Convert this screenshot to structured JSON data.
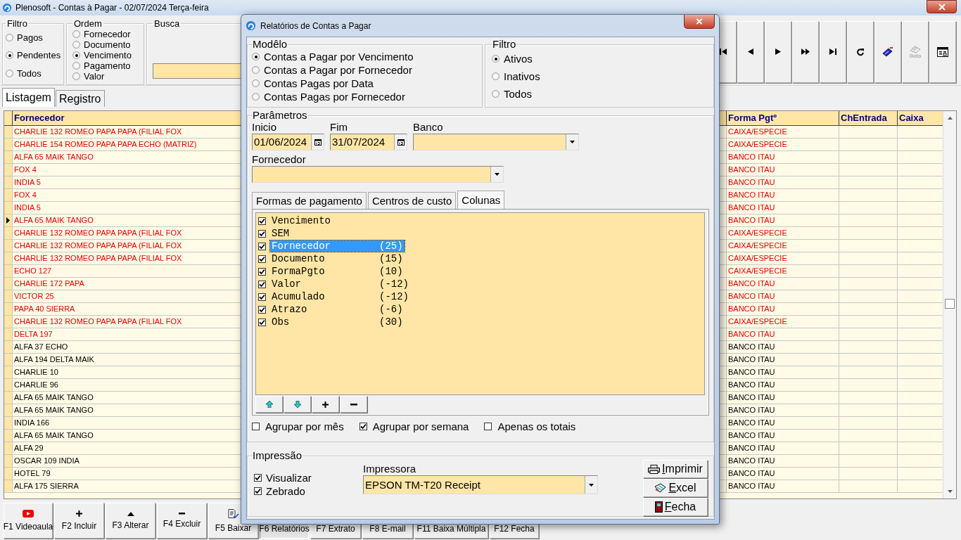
{
  "window": {
    "title": "Plenosoft - Contas à Pagar - 02/07/2024 Terça-feira"
  },
  "filtro": {
    "title": "Filtro",
    "options": [
      {
        "label": "Pagos",
        "selected": false
      },
      {
        "label": "Pendentes",
        "selected": true
      },
      {
        "label": "Todos",
        "selected": false
      }
    ]
  },
  "ordem": {
    "title": "Ordem",
    "options": [
      {
        "label": "Fornecedor",
        "selected": false
      },
      {
        "label": "Documento",
        "selected": false
      },
      {
        "label": "Vencimento",
        "selected": true
      },
      {
        "label": "Pagamento",
        "selected": false
      },
      {
        "label": "Valor",
        "selected": false
      }
    ]
  },
  "busca": {
    "title": "Busca"
  },
  "toolbar": [
    {
      "kind": "first",
      "disabled": false
    },
    {
      "kind": "prev",
      "disabled": false
    },
    {
      "kind": "next",
      "disabled": false
    },
    {
      "kind": "next_page",
      "disabled": false
    },
    {
      "kind": "last",
      "disabled": false
    },
    {
      "kind": "refresh",
      "disabled": false
    },
    {
      "kind": "tag",
      "disabled": false
    },
    {
      "kind": "goto",
      "label": "Goto",
      "disabled": true
    },
    {
      "kind": "form",
      "disabled": false
    }
  ],
  "tabs": [
    {
      "label": "Listagem",
      "selected": true
    },
    {
      "label": "Registro",
      "selected": false
    }
  ],
  "table": {
    "columns": [
      "Fornecedor",
      "Forma Pgtº",
      "ChEntrada",
      "Caixa"
    ],
    "rows": [
      {
        "fornecedor": "CHARLIE 132 ROMEO PAPA PAPA (FILIAL FOX",
        "forma": "CAIXA/ESPECIE",
        "overdue": true,
        "selected": false
      },
      {
        "fornecedor": "CHARLIE 154 ROMEO PAPA PAPA ECHO (MATRIZ)",
        "forma": "CAIXA/ESPECIE",
        "overdue": true,
        "selected": false
      },
      {
        "fornecedor": "ALFA 65 MAIK TANGO",
        "forma": "BANCO ITAU",
        "overdue": true,
        "selected": false
      },
      {
        "fornecedor": "FOX 4",
        "forma": "BANCO ITAU",
        "overdue": true,
        "selected": false
      },
      {
        "fornecedor": "INDIA 5",
        "forma": "BANCO ITAU",
        "overdue": true,
        "selected": false
      },
      {
        "fornecedor": "FOX 4",
        "forma": "BANCO ITAU",
        "overdue": true,
        "selected": false
      },
      {
        "fornecedor": "INDIA 5",
        "forma": "BANCO ITAU",
        "overdue": true,
        "selected": false
      },
      {
        "fornecedor": "ALFA 65 MAIK TANGO",
        "forma": "BANCO ITAU",
        "overdue": true,
        "selected": true
      },
      {
        "fornecedor": "CHARLIE 132 ROMEO PAPA PAPA (FILIAL FOX",
        "forma": "CAIXA/ESPECIE",
        "overdue": true,
        "selected": false
      },
      {
        "fornecedor": "CHARLIE 132 ROMEO PAPA PAPA (FILIAL FOX",
        "forma": "CAIXA/ESPECIE",
        "overdue": true,
        "selected": false
      },
      {
        "fornecedor": "CHARLIE 132 ROMEO PAPA PAPA (FILIAL FOX",
        "forma": "CAIXA/ESPECIE",
        "overdue": true,
        "selected": false
      },
      {
        "fornecedor": "ECHO 127",
        "forma": "CAIXA/ESPECIE",
        "overdue": true,
        "selected": false
      },
      {
        "fornecedor": "CHARLIE 172 PAPA",
        "forma": "BANCO ITAU",
        "overdue": true,
        "selected": false
      },
      {
        "fornecedor": "VICTOR 25",
        "forma": "BANCO ITAU",
        "overdue": true,
        "selected": false
      },
      {
        "fornecedor": "PAPA 40 SIERRA",
        "forma": "BANCO ITAU",
        "overdue": true,
        "selected": false
      },
      {
        "fornecedor": "CHARLIE 132 ROMEO PAPA PAPA (FILIAL FOX",
        "forma": "CAIXA/ESPECIE",
        "overdue": true,
        "selected": false
      },
      {
        "fornecedor": "DELTA 197",
        "forma": "BANCO ITAU",
        "overdue": true,
        "selected": false
      },
      {
        "fornecedor": "ALFA 37 ECHO",
        "forma": "BANCO ITAU",
        "overdue": false,
        "selected": false
      },
      {
        "fornecedor": "ALFA 194 DELTA MAIK",
        "forma": "BANCO ITAU",
        "overdue": false,
        "selected": false
      },
      {
        "fornecedor": "CHARLIE 10",
        "forma": "BANCO ITAU",
        "overdue": false,
        "selected": false
      },
      {
        "fornecedor": "CHARLIE 96",
        "forma": "BANCO ITAU",
        "overdue": false,
        "selected": false
      },
      {
        "fornecedor": "ALFA 65 MAIK TANGO",
        "forma": "BANCO ITAU",
        "overdue": false,
        "selected": false
      },
      {
        "fornecedor": "ALFA 65 MAIK TANGO",
        "forma": "BANCO ITAU",
        "overdue": false,
        "selected": false
      },
      {
        "fornecedor": "INDIA 166",
        "forma": "BANCO ITAU",
        "overdue": false,
        "selected": false
      },
      {
        "fornecedor": "ALFA 65 MAIK TANGO",
        "forma": "BANCO ITAU",
        "overdue": false,
        "selected": false
      },
      {
        "fornecedor": "ALFA 29",
        "forma": "BANCO ITAU",
        "overdue": false,
        "selected": false
      },
      {
        "fornecedor": "OSCAR 109 INDIA",
        "forma": "BANCO ITAU",
        "overdue": false,
        "selected": false
      },
      {
        "fornecedor": "HOTEL 79",
        "forma": "BANCO ITAU",
        "overdue": false,
        "selected": false
      },
      {
        "fornecedor": "ALFA 175 SIERRA",
        "forma": "BANCO ITAU",
        "overdue": false,
        "selected": false
      }
    ]
  },
  "function_keys": [
    {
      "label": "F1 Videoaula",
      "kind": "video",
      "pressed": false
    },
    {
      "label": "F2 Incluir",
      "kind": "add",
      "pressed": false
    },
    {
      "label": "F3 Alterar",
      "kind": "edit",
      "pressed": false
    },
    {
      "label": "F4 Excluir",
      "kind": "remove",
      "pressed": false
    },
    {
      "label": "F5 Baixar",
      "kind": "settle",
      "pressed": false
    },
    {
      "label": "F6 Relatórios",
      "kind": "text",
      "pressed": true
    },
    {
      "label": "F7 Extrato",
      "kind": "text",
      "pressed": false
    },
    {
      "label": "F8 E-mail",
      "kind": "text",
      "pressed": false
    },
    {
      "label": "F11 Baixa Múltipla",
      "kind": "text",
      "pressed": false
    },
    {
      "label": "F12 Fecha",
      "kind": "text",
      "pressed": false
    }
  ],
  "dialog": {
    "title": "Relatórios de Contas a Pagar",
    "modelo": {
      "title": "Modêlo",
      "options": [
        {
          "label": "Contas a Pagar por Vencimento",
          "selected": true
        },
        {
          "label": "Contas a Pagar por Fornecedor",
          "selected": false
        },
        {
          "label": "Contas Pagas por Data",
          "selected": false
        },
        {
          "label": "Contas Pagas por Fornecedor",
          "selected": false
        }
      ]
    },
    "filtro": {
      "title": "Filtro",
      "options": [
        {
          "label": "Ativos",
          "selected": true
        },
        {
          "label": "Inativos",
          "selected": false
        },
        {
          "label": "Todos",
          "selected": false
        }
      ]
    },
    "parametros": {
      "title": "Parâmetros",
      "inicio": {
        "label": "Inicio",
        "value": "01/06/2024"
      },
      "fim": {
        "label": "Fim",
        "value": "31/07/2024"
      },
      "banco": {
        "label": "Banco"
      },
      "fornecedor": {
        "label": "Fornecedor"
      },
      "tabs": [
        {
          "label": "Formas de pagamento",
          "selected": false
        },
        {
          "label": "Centros de custo",
          "selected": false
        },
        {
          "label": "Colunas",
          "selected": true
        }
      ],
      "columns": [
        {
          "name": "Vencimento",
          "checked": true,
          "selected": false
        },
        {
          "name": "SEM",
          "checked": true,
          "selected": false
        },
        {
          "name": "Fornecedor",
          "width": "(25)",
          "checked": true,
          "selected": true
        },
        {
          "name": "Documento",
          "width": "(15)",
          "checked": true,
          "selected": false
        },
        {
          "name": "FormaPgto",
          "width": "(10)",
          "checked": true,
          "selected": false
        },
        {
          "name": "Valor",
          "width": "(-12)",
          "checked": true,
          "selected": false
        },
        {
          "name": "Acumulado",
          "width": "(-12)",
          "checked": true,
          "selected": false
        },
        {
          "name": "Atrazo",
          "width": "(-6)",
          "checked": true,
          "selected": false
        },
        {
          "name": "Obs",
          "width": "(30)",
          "checked": true,
          "selected": false
        }
      ],
      "list_buttons": [
        {
          "kind": "up"
        },
        {
          "kind": "down"
        },
        {
          "kind": "add"
        },
        {
          "kind": "remove"
        }
      ],
      "options": [
        {
          "label": "Agrupar por mês",
          "checked": false
        },
        {
          "label": "Agrupar por semana",
          "checked": true
        },
        {
          "label": "Apenas os totais",
          "checked": false
        }
      ]
    },
    "impressao": {
      "title": "Impressão",
      "options": [
        {
          "label": "Visualizar",
          "checked": true
        },
        {
          "label": "Zebrado",
          "checked": true
        }
      ],
      "printer": {
        "label": "Impressora",
        "value": "EPSON TM-T20 Receipt"
      },
      "buttons": [
        {
          "label": "Imprimir",
          "kind": "print"
        },
        {
          "label": "Excel",
          "kind": "excel"
        },
        {
          "label": "Fecha",
          "kind": "close"
        }
      ]
    }
  }
}
